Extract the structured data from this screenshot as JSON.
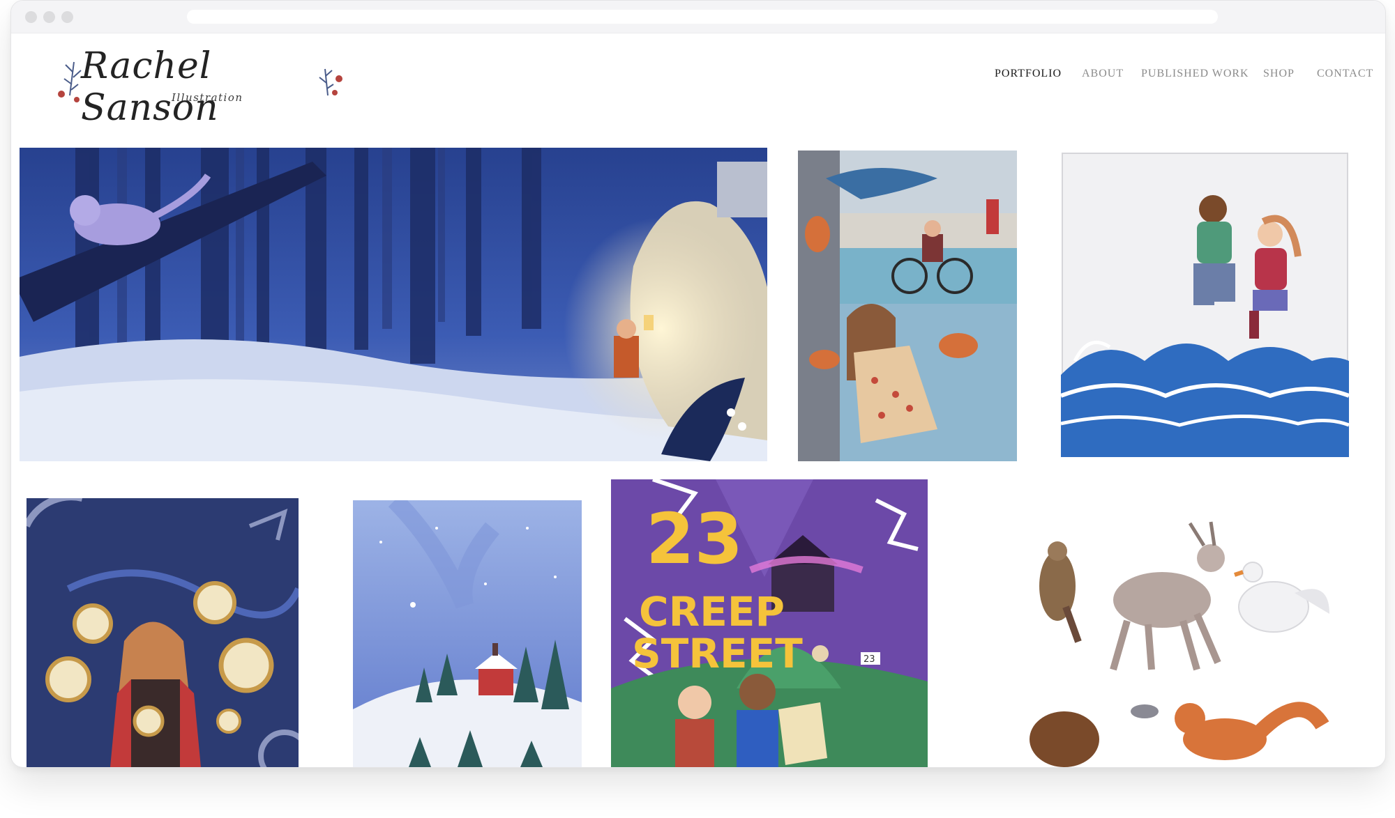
{
  "site": {
    "logo_name": "Rachel Sanson",
    "logo_subtitle": "Illustration"
  },
  "nav": {
    "items": [
      {
        "label": "PORTFOLIO",
        "active": true
      },
      {
        "label": "ABOUT",
        "active": false
      },
      {
        "label": "PUBLISHED WORK",
        "active": false
      },
      {
        "label": "SHOP",
        "active": false
      },
      {
        "label": "CONTACT",
        "active": false
      }
    ]
  },
  "gallery": {
    "creep_street_title_number": "23",
    "creep_street_title_line1": "CREEP",
    "creep_street_title_line2": "STREET",
    "creep_street_sign_number": "23"
  },
  "colors": {
    "nav_active": "#1a1a1a",
    "nav_inactive": "#8b8b8b",
    "forest_blue": "#2e4aa0",
    "ocean_blue": "#2f6cc0",
    "night_navy": "#2c3b72",
    "creep_purple": "#6c49a8",
    "title_yellow": "#f5c33b"
  }
}
